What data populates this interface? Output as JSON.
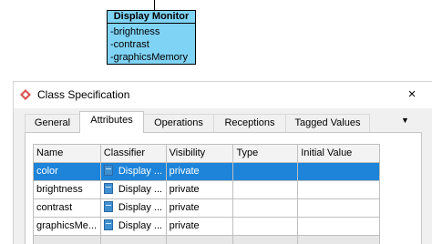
{
  "uml_class": {
    "name": "Display Monitor",
    "attributes": [
      "-brightness",
      "-contrast",
      "-graphicsMemory"
    ]
  },
  "dialog": {
    "title": "Class Specification",
    "close_icon": "×",
    "tabs": [
      {
        "label": "General"
      },
      {
        "label": "Attributes",
        "active": true
      },
      {
        "label": "Operations"
      },
      {
        "label": "Receptions"
      },
      {
        "label": "Tagged Values"
      }
    ],
    "overflow_icon": "▼"
  },
  "attributes_table": {
    "headers": [
      "Name",
      "Classifier",
      "Visibility",
      "Type",
      "Initial Value"
    ],
    "rows": [
      {
        "name": "color",
        "classifier": "Display ...",
        "visibility": "private",
        "type": "",
        "initial": ""
      },
      {
        "name": "brightness",
        "classifier": "Display ...",
        "visibility": "private",
        "type": "",
        "initial": ""
      },
      {
        "name": "contrast",
        "classifier": "Display ...",
        "visibility": "private",
        "type": "",
        "initial": ""
      },
      {
        "name": "graphicsMe...",
        "classifier": "Display ...",
        "visibility": "private",
        "type": "",
        "initial": ""
      }
    ],
    "selected_row": 0
  },
  "colors": {
    "uml_fill": "#7fd3f5",
    "selection": "#1d84d9",
    "dialog_bg": "#f0f0f0"
  }
}
